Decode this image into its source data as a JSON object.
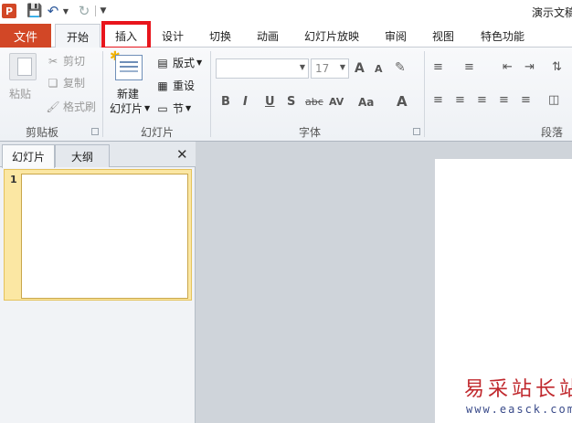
{
  "title_bar": {
    "app_icon_letter": "P",
    "document_title": "演示文稿"
  },
  "tabs": {
    "file": "文件",
    "home": "开始",
    "insert": "插入",
    "design": "设计",
    "transitions": "切换",
    "animations": "动画",
    "slideshow": "幻灯片放映",
    "review": "审阅",
    "view": "视图",
    "special": "特色功能"
  },
  "ribbon": {
    "clipboard": {
      "paste": "粘贴",
      "cut": "剪切",
      "copy": "复制",
      "format_painter": "格式刷",
      "label": "剪贴板"
    },
    "slides": {
      "new_slide_line1": "新建",
      "new_slide_line2": "幻灯片",
      "layout": "版式",
      "reset": "重设",
      "section": "节",
      "label": "幻灯片"
    },
    "font": {
      "font_name": "",
      "font_size": "17",
      "bold": "B",
      "italic": "I",
      "underline": "U",
      "shadow": "S",
      "strikethrough": "abc",
      "spacing": "AV",
      "change_case": "Aa",
      "font_color": "A",
      "grow": "A",
      "shrink": "A",
      "label": "字体"
    },
    "paragraph": {
      "label": "段落"
    }
  },
  "panel": {
    "tab_slides": "幻灯片",
    "tab_outline": "大纲",
    "slide_number": "1"
  },
  "watermark": {
    "text": "易采站长站",
    "url": "www.easck.com"
  }
}
